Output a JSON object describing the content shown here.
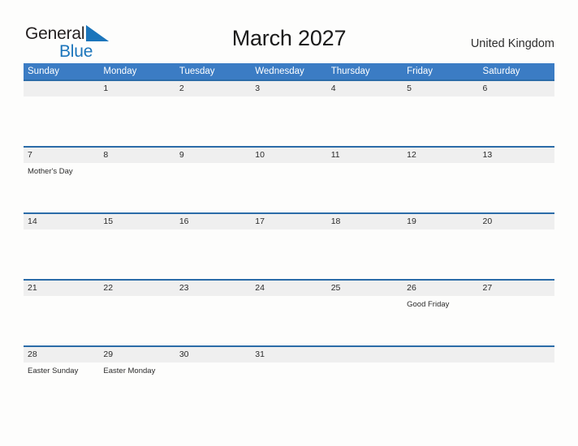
{
  "brand": {
    "name_part1": "General",
    "name_part2": "Blue",
    "flag_icon": "blue-triangle-flag-icon",
    "accent_color": "#1b75bb"
  },
  "header": {
    "month_title": "March 2027",
    "region": "United Kingdom"
  },
  "theme": {
    "header_bar_color": "#3b7cc4",
    "row_rule_color": "#2b6ca8",
    "date_band_color": "#efefef",
    "page_background": "#fdfdfc",
    "text_color": "#2b2b2b"
  },
  "calendar": {
    "weekday_headers": [
      "Sunday",
      "Monday",
      "Tuesday",
      "Wednesday",
      "Thursday",
      "Friday",
      "Saturday"
    ],
    "weeks": [
      [
        {
          "date": "",
          "events": []
        },
        {
          "date": "1",
          "events": []
        },
        {
          "date": "2",
          "events": []
        },
        {
          "date": "3",
          "events": []
        },
        {
          "date": "4",
          "events": []
        },
        {
          "date": "5",
          "events": []
        },
        {
          "date": "6",
          "events": []
        }
      ],
      [
        {
          "date": "7",
          "events": [
            "Mother's Day"
          ]
        },
        {
          "date": "8",
          "events": []
        },
        {
          "date": "9",
          "events": []
        },
        {
          "date": "10",
          "events": []
        },
        {
          "date": "11",
          "events": []
        },
        {
          "date": "12",
          "events": []
        },
        {
          "date": "13",
          "events": []
        }
      ],
      [
        {
          "date": "14",
          "events": []
        },
        {
          "date": "15",
          "events": []
        },
        {
          "date": "16",
          "events": []
        },
        {
          "date": "17",
          "events": []
        },
        {
          "date": "18",
          "events": []
        },
        {
          "date": "19",
          "events": []
        },
        {
          "date": "20",
          "events": []
        }
      ],
      [
        {
          "date": "21",
          "events": []
        },
        {
          "date": "22",
          "events": []
        },
        {
          "date": "23",
          "events": []
        },
        {
          "date": "24",
          "events": []
        },
        {
          "date": "25",
          "events": []
        },
        {
          "date": "26",
          "events": [
            "Good Friday"
          ]
        },
        {
          "date": "27",
          "events": []
        }
      ],
      [
        {
          "date": "28",
          "events": [
            "Easter Sunday"
          ]
        },
        {
          "date": "29",
          "events": [
            "Easter Monday"
          ]
        },
        {
          "date": "30",
          "events": []
        },
        {
          "date": "31",
          "events": []
        },
        {
          "date": "",
          "events": []
        },
        {
          "date": "",
          "events": []
        },
        {
          "date": "",
          "events": []
        }
      ]
    ]
  }
}
